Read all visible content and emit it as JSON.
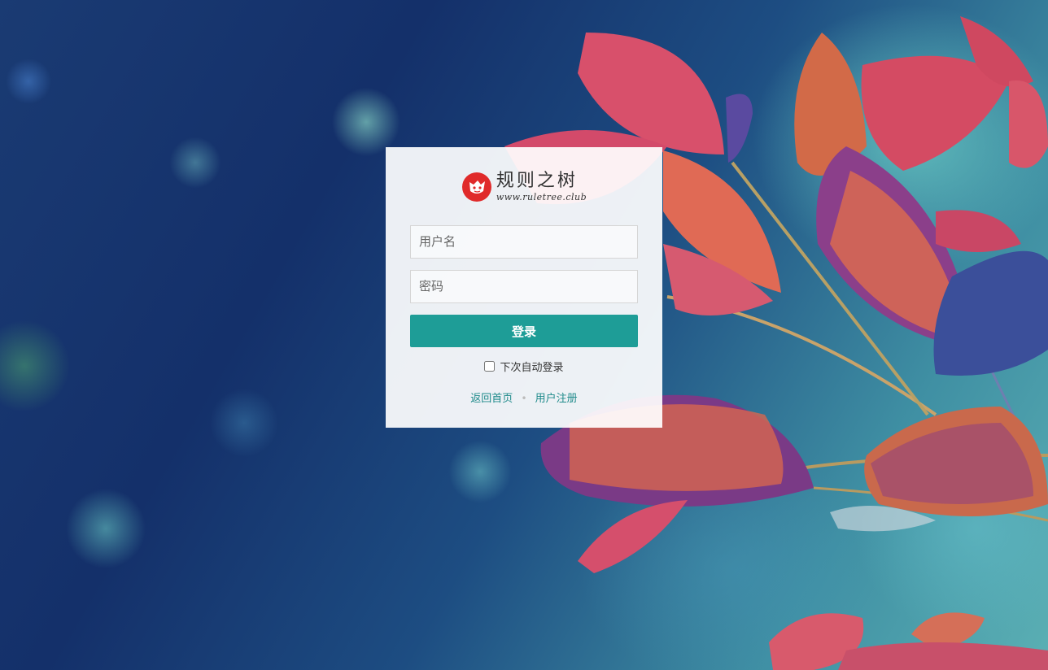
{
  "logo": {
    "title": "规则之树",
    "url": "www.ruletree.club"
  },
  "form": {
    "username_placeholder": "用户名",
    "password_placeholder": "密码",
    "submit_label": "登录",
    "remember_label": "下次自动登录",
    "remember_checked": false
  },
  "links": {
    "home_label": "返回首页",
    "separator": "•",
    "register_label": "用户注册"
  },
  "colors": {
    "accent": "#1e9d97",
    "link": "#1e8a8a",
    "logo_red": "#e02a2a"
  },
  "icons": {
    "logo": "ruletree-logo-icon"
  }
}
